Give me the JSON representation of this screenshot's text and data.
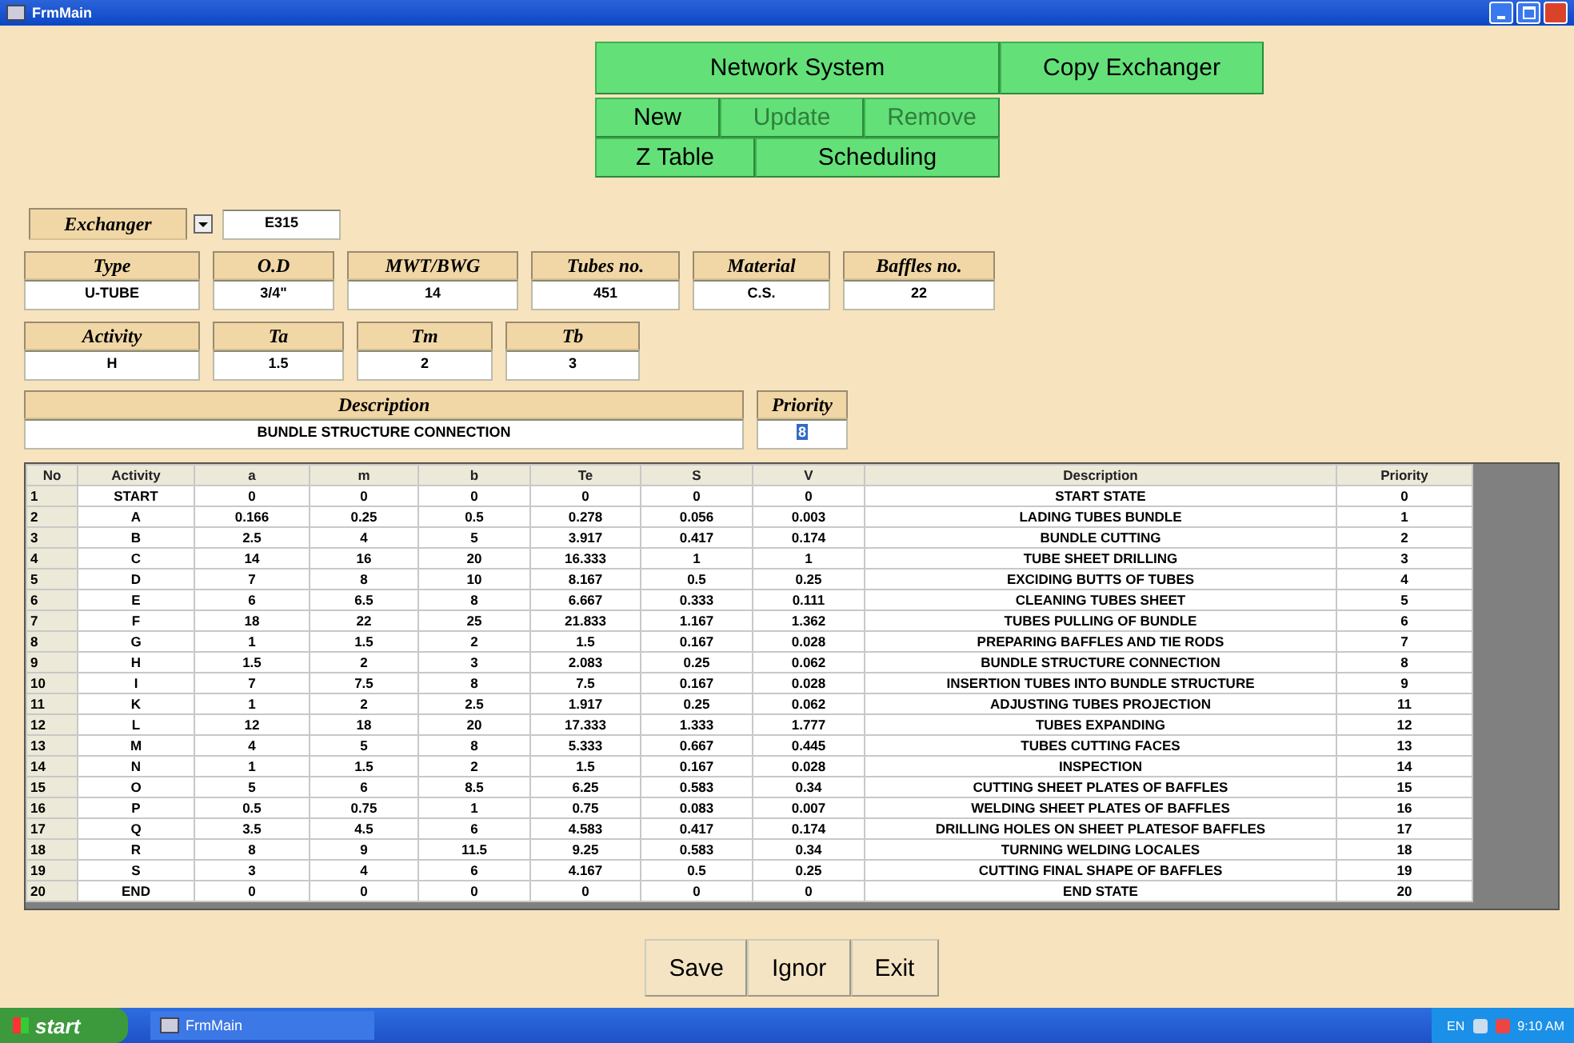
{
  "window": {
    "title": "FrmMain"
  },
  "command_rows": [
    {
      "buttons": [
        {
          "label": "Network System",
          "disabled": false
        },
        {
          "label": "Copy Exchanger",
          "disabled": false
        }
      ]
    },
    {
      "buttons": [
        {
          "label": "New",
          "disabled": false
        },
        {
          "label": "Update",
          "disabled": true
        },
        {
          "label": "Remove",
          "disabled": true
        }
      ]
    },
    {
      "buttons": [
        {
          "label": "Z Table",
          "disabled": false
        },
        {
          "label": "Scheduling",
          "disabled": false
        }
      ]
    }
  ],
  "exchanger": {
    "label": "Exchanger",
    "value": "E315"
  },
  "fields_row_1": [
    {
      "label": "Type",
      "value": "U-TUBE"
    },
    {
      "label": "O.D",
      "value": "3/4\""
    },
    {
      "label": "MWT/BWG",
      "value": "14"
    },
    {
      "label": "Tubes no.",
      "value": "451"
    },
    {
      "label": "Material",
      "value": "C.S."
    },
    {
      "label": "Baffles no.",
      "value": "22"
    }
  ],
  "fields_row_2": [
    {
      "label": "Activity",
      "value": "H"
    },
    {
      "label": "Ta",
      "value": "1.5"
    },
    {
      "label": "Tm",
      "value": "2"
    },
    {
      "label": "Tb",
      "value": "3"
    }
  ],
  "description": {
    "label": "Description",
    "value": "BUNDLE STRUCTURE CONNECTION"
  },
  "priority": {
    "label": "Priority",
    "value": "8",
    "selected": true
  },
  "table": {
    "columns": [
      "No",
      "Activity",
      "a",
      "m",
      "b",
      "Te",
      "S",
      "V",
      "Description",
      "Priority"
    ],
    "rows": [
      [
        "1",
        "START",
        "0",
        "0",
        "0",
        "0",
        "0",
        "0",
        "START STATE",
        "0"
      ],
      [
        "2",
        "A",
        "0.166",
        "0.25",
        "0.5",
        "0.278",
        "0.056",
        "0.003",
        "LADING TUBES BUNDLE",
        "1"
      ],
      [
        "3",
        "B",
        "2.5",
        "4",
        "5",
        "3.917",
        "0.417",
        "0.174",
        "BUNDLE CUTTING",
        "2"
      ],
      [
        "4",
        "C",
        "14",
        "16",
        "20",
        "16.333",
        "1",
        "1",
        "TUBE SHEET DRILLING",
        "3"
      ],
      [
        "5",
        "D",
        "7",
        "8",
        "10",
        "8.167",
        "0.5",
        "0.25",
        "EXCIDING BUTTS OF TUBES",
        "4"
      ],
      [
        "6",
        "E",
        "6",
        "6.5",
        "8",
        "6.667",
        "0.333",
        "0.111",
        "CLEANING TUBES SHEET",
        "5"
      ],
      [
        "7",
        "F",
        "18",
        "22",
        "25",
        "21.833",
        "1.167",
        "1.362",
        "TUBES PULLING OF BUNDLE",
        "6"
      ],
      [
        "8",
        "G",
        "1",
        "1.5",
        "2",
        "1.5",
        "0.167",
        "0.028",
        "PREPARING BAFFLES AND TIE RODS",
        "7"
      ],
      [
        "9",
        "H",
        "1.5",
        "2",
        "3",
        "2.083",
        "0.25",
        "0.062",
        "BUNDLE STRUCTURE CONNECTION",
        "8"
      ],
      [
        "10",
        "I",
        "7",
        "7.5",
        "8",
        "7.5",
        "0.167",
        "0.028",
        "INSERTION TUBES INTO BUNDLE STRUCTURE",
        "9"
      ],
      [
        "11",
        "K",
        "1",
        "2",
        "2.5",
        "1.917",
        "0.25",
        "0.062",
        "ADJUSTING TUBES PROJECTION",
        "11"
      ],
      [
        "12",
        "L",
        "12",
        "18",
        "20",
        "17.333",
        "1.333",
        "1.777",
        "TUBES EXPANDING",
        "12"
      ],
      [
        "13",
        "M",
        "4",
        "5",
        "8",
        "5.333",
        "0.667",
        "0.445",
        "TUBES CUTTING FACES",
        "13"
      ],
      [
        "14",
        "N",
        "1",
        "1.5",
        "2",
        "1.5",
        "0.167",
        "0.028",
        "INSPECTION",
        "14"
      ],
      [
        "15",
        "O",
        "5",
        "6",
        "8.5",
        "6.25",
        "0.583",
        "0.34",
        "CUTTING SHEET PLATES OF BAFFLES",
        "15"
      ],
      [
        "16",
        "P",
        "0.5",
        "0.75",
        "1",
        "0.75",
        "0.083",
        "0.007",
        "WELDING SHEET PLATES OF BAFFLES",
        "16"
      ],
      [
        "17",
        "Q",
        "3.5",
        "4.5",
        "6",
        "4.583",
        "0.417",
        "0.174",
        "DRILLING HOLES ON SHEET PLATESOF BAFFLES",
        "17"
      ],
      [
        "18",
        "R",
        "8",
        "9",
        "11.5",
        "9.25",
        "0.583",
        "0.34",
        "TURNING WELDING LOCALES",
        "18"
      ],
      [
        "19",
        "S",
        "3",
        "4",
        "6",
        "4.167",
        "0.5",
        "0.25",
        "CUTTING FINAL SHAPE OF BAFFLES",
        "19"
      ],
      [
        "20",
        "END",
        "0",
        "0",
        "0",
        "0",
        "0",
        "0",
        "END STATE",
        "20"
      ]
    ]
  },
  "bottom_buttons": [
    "Save",
    "Ignor",
    "Exit"
  ],
  "taskbar": {
    "start": "start",
    "tasks": [
      {
        "label": "FrmMain"
      }
    ],
    "language": "EN",
    "clock": "9:10 AM"
  }
}
